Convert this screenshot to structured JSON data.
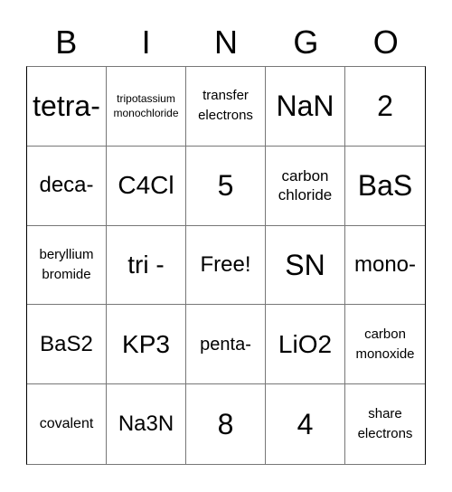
{
  "header": {
    "letters": [
      "B",
      "I",
      "N",
      "G",
      "O"
    ]
  },
  "card": {
    "rows": [
      [
        {
          "text": "tetra-",
          "size": "xl"
        },
        {
          "text": "tripotassium monochloride",
          "size": "tiny"
        },
        {
          "text": "transfer electrons",
          "size": "xxs"
        },
        {
          "text": "NaN",
          "size": "xl"
        },
        {
          "text": "2",
          "size": "xl"
        }
      ],
      [
        {
          "text": "deca-",
          "size": "m"
        },
        {
          "text": "C4Cl",
          "size": "l"
        },
        {
          "text": "5",
          "size": "xl"
        },
        {
          "text": "carbon chloride",
          "size": "xs"
        },
        {
          "text": "BaS",
          "size": "xl"
        }
      ],
      [
        {
          "text": "beryllium bromide",
          "size": "xxs"
        },
        {
          "text": "tri -",
          "size": "l"
        },
        {
          "text": "Free!",
          "size": "m"
        },
        {
          "text": "SN",
          "size": "xl"
        },
        {
          "text": "mono-",
          "size": "m"
        }
      ],
      [
        {
          "text": "BaS2",
          "size": "m"
        },
        {
          "text": "KP3",
          "size": "l"
        },
        {
          "text": "penta-",
          "size": "s"
        },
        {
          "text": "LiO2",
          "size": "l"
        },
        {
          "text": "carbon monoxide",
          "size": "xxs"
        }
      ],
      [
        {
          "text": "covalent",
          "size": "sm2"
        },
        {
          "text": "Na3N",
          "size": "m"
        },
        {
          "text": "8",
          "size": "xl"
        },
        {
          "text": "4",
          "size": "xl"
        },
        {
          "text": "share electrons",
          "size": "xxs"
        }
      ]
    ]
  }
}
